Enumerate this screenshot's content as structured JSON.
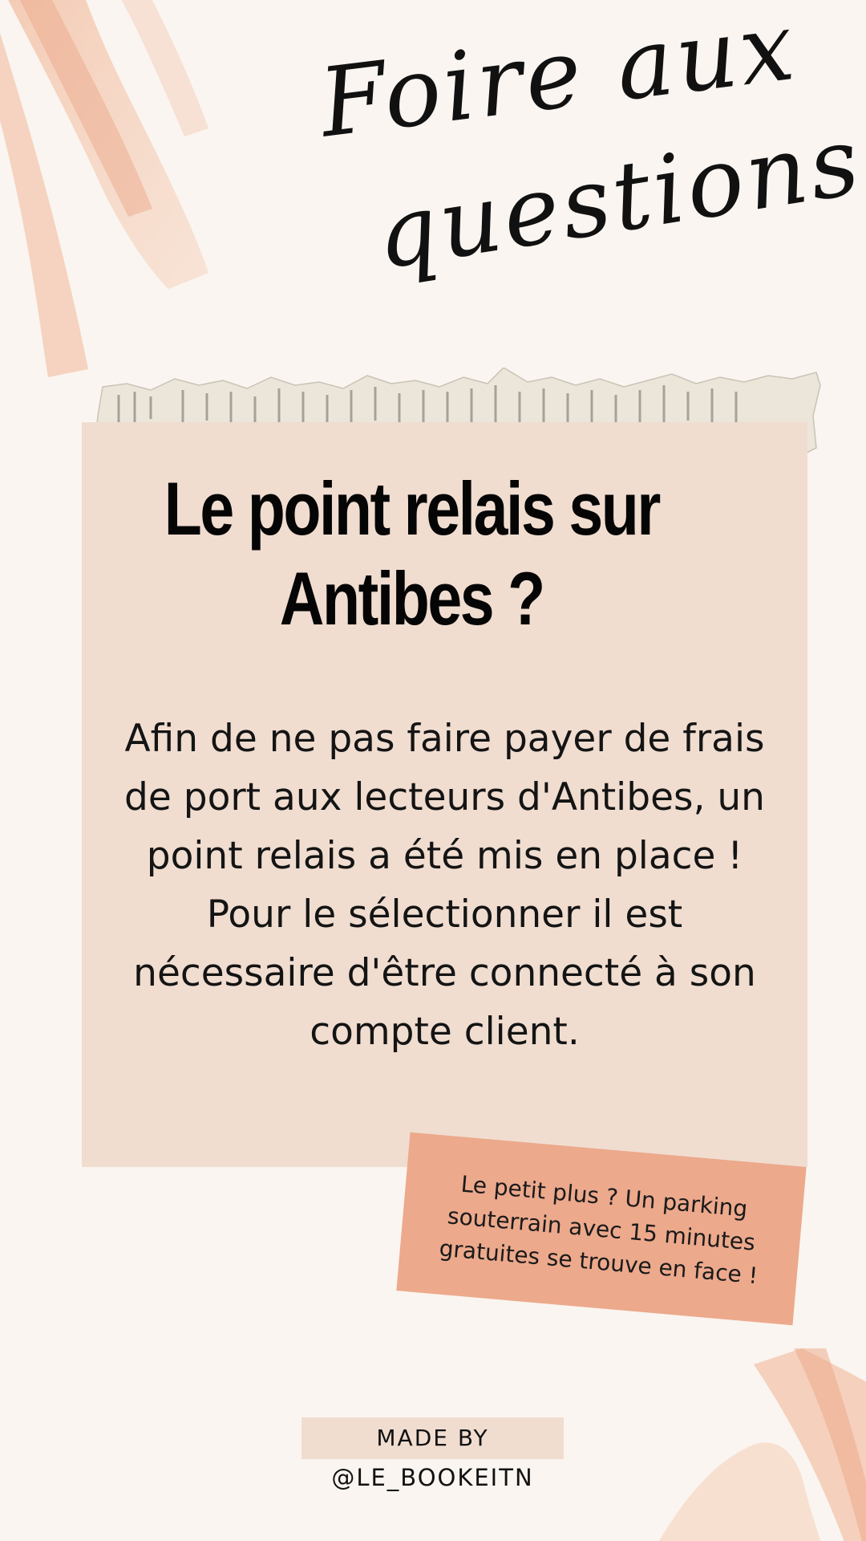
{
  "header": {
    "script_line_1": "Foire aux",
    "script_line_2": "questions"
  },
  "card": {
    "title": "Le point relais sur Antibes ?",
    "body": "Afin de ne pas faire payer de frais de port aux lecteurs d'Antibes, un point relais a été mis en place ! Pour le sélectionner il est nécessaire d'être connecté à son compte client."
  },
  "note": {
    "text": "Le petit plus ? Un parking souterrain avec 15 minutes gratuites se trouve en face !"
  },
  "credit": {
    "made_by": "MADE BY",
    "handle": "@LE_BOOKEITN"
  },
  "colors": {
    "background": "#faf5f0",
    "card": "#f0ddd0",
    "note": "#eca98c",
    "brush": "#eeb597"
  },
  "decorations": {
    "brush_strokes": "watercolor-brush-stroke",
    "paper_strip": "torn-book-page"
  }
}
